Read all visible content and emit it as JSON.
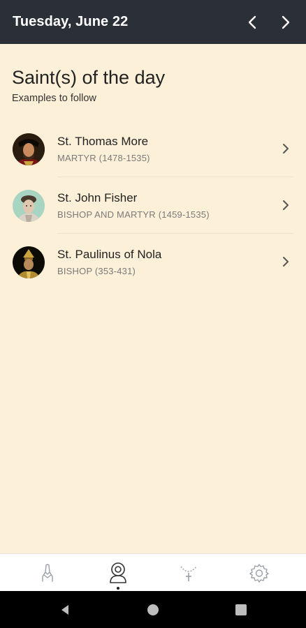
{
  "header": {
    "date": "Tuesday, June 22",
    "prev_icon": "chevron-left-icon",
    "next_icon": "chevron-right-icon",
    "background": "#2b3038"
  },
  "main": {
    "title": "Saint(s) of the day",
    "subtitle": "Examples to follow",
    "background": "#fdf0d8"
  },
  "saints": [
    {
      "name": "St. Thomas More",
      "description": "MARTYR (1478-1535)",
      "icon": "portrait-thomas-more"
    },
    {
      "name": "St. John Fisher",
      "description": "BISHOP AND MARTYR (1459-1535)",
      "icon": "portrait-john-fisher"
    },
    {
      "name": "St. Paulinus of Nola",
      "description": "BISHOP (353-431)",
      "icon": "portrait-paulinus"
    }
  ],
  "bottom_nav": {
    "tabs": [
      {
        "icon": "praying-hands-icon",
        "active": false
      },
      {
        "icon": "saint-person-icon",
        "active": true
      },
      {
        "icon": "rosary-icon",
        "active": false
      },
      {
        "icon": "gear-icon",
        "active": false
      }
    ]
  },
  "system_nav": {
    "buttons": [
      "back-icon",
      "home-icon",
      "recents-icon"
    ]
  }
}
